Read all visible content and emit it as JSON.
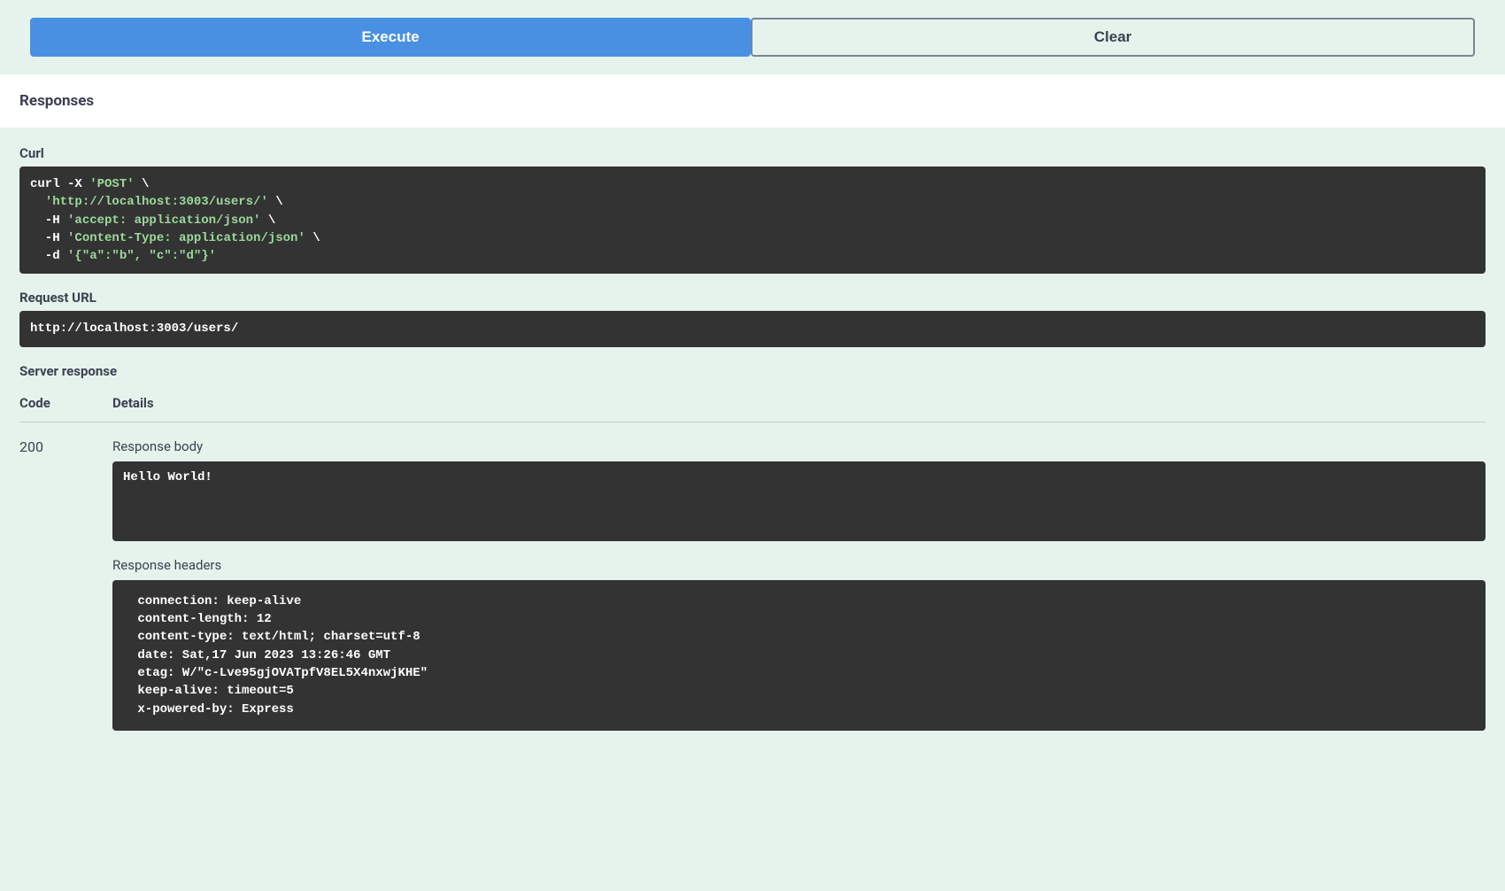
{
  "buttons": {
    "execute": "Execute",
    "clear": "Clear"
  },
  "responses_heading": "Responses",
  "curl": {
    "label": "Curl",
    "p1": "curl -X ",
    "s1": "'POST'",
    "p2": " \\\n  ",
    "s2": "'http://localhost:3003/users/'",
    "p3": " \\\n  -H ",
    "s3": "'accept: application/json'",
    "p4": " \\\n  -H ",
    "s4": "'Content-Type: application/json'",
    "p5": " \\\n  -d ",
    "s5": "'{\"a\":\"b\", \"c\":\"d\"}'"
  },
  "request_url": {
    "label": "Request URL",
    "value": "http://localhost:3003/users/"
  },
  "server_response_label": "Server response",
  "table": {
    "code_header": "Code",
    "details_header": "Details"
  },
  "response": {
    "code": "200",
    "body_label": "Response body",
    "body": "Hello World!",
    "headers_label": "Response headers",
    "headers": " connection: keep-alive \n content-length: 12 \n content-type: text/html; charset=utf-8 \n date: Sat,17 Jun 2023 13:26:46 GMT \n etag: W/\"c-Lve95gjOVATpfV8EL5X4nxwjKHE\" \n keep-alive: timeout=5 \n x-powered-by: Express "
  }
}
